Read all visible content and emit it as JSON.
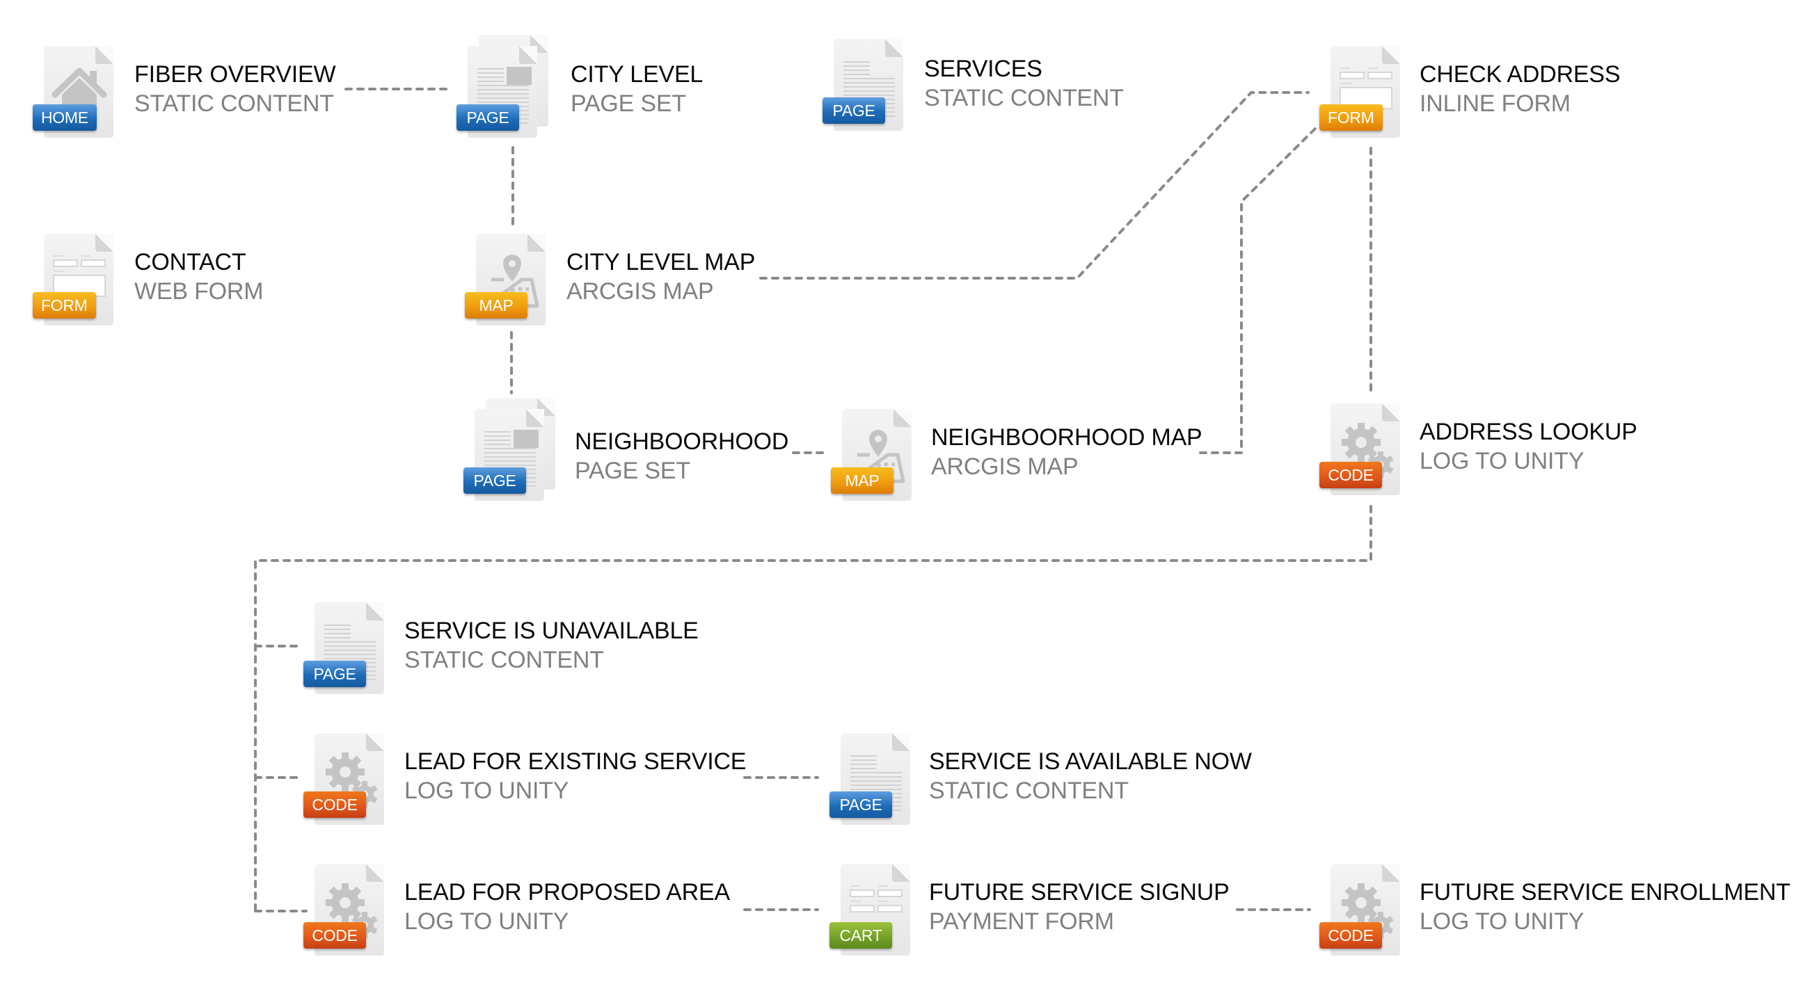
{
  "diagram": {
    "badge_colors": {
      "blue": "#1e6cb8",
      "orange": "#ef9a0f",
      "red": "#e0561a",
      "green": "#71a027"
    },
    "connector_color": "#8a8a8a",
    "nodes": [
      {
        "id": "fiber-overview",
        "badge": "HOME",
        "icon": "home-icon",
        "title": "FIBER OVERVIEW",
        "subtitle": "STATIC CONTENT"
      },
      {
        "id": "city-level",
        "badge": "PAGE",
        "icon": "page-set-icon",
        "title": "CITY LEVEL",
        "subtitle": "PAGE SET"
      },
      {
        "id": "services",
        "badge": "PAGE",
        "icon": "page-icon",
        "title": "SERVICES",
        "subtitle": "STATIC CONTENT"
      },
      {
        "id": "check-address",
        "badge": "FORM",
        "icon": "form-icon",
        "title": "CHECK ADDRESS",
        "subtitle": "INLINE FORM"
      },
      {
        "id": "contact",
        "badge": "FORM",
        "icon": "form-icon",
        "title": "CONTACT",
        "subtitle": "WEB FORM"
      },
      {
        "id": "city-level-map",
        "badge": "MAP",
        "icon": "map-icon",
        "title": "CITY LEVEL MAP",
        "subtitle": "ARCGIS MAP"
      },
      {
        "id": "neighboorhood",
        "badge": "PAGE",
        "icon": "page-set-icon",
        "title": "NEIGHBOORHOOD",
        "subtitle": "PAGE SET"
      },
      {
        "id": "neighboorhood-map",
        "badge": "MAP",
        "icon": "map-icon",
        "title": "NEIGHBOORHOOD MAP",
        "subtitle": "ARCGIS MAP"
      },
      {
        "id": "address-lookup",
        "badge": "CODE",
        "icon": "gears-icon",
        "title": "ADDRESS LOOKUP",
        "subtitle": "LOG TO UNITY"
      },
      {
        "id": "service-unavailable",
        "badge": "PAGE",
        "icon": "page-icon",
        "title": "SERVICE IS UNAVAILABLE",
        "subtitle": "STATIC CONTENT"
      },
      {
        "id": "lead-existing-service",
        "badge": "CODE",
        "icon": "gears-icon",
        "title": "LEAD FOR EXISTING SERVICE",
        "subtitle": "LOG TO UNITY"
      },
      {
        "id": "service-available-now",
        "badge": "PAGE",
        "icon": "page-icon",
        "title": "SERVICE IS AVAILABLE NOW",
        "subtitle": "STATIC CONTENT"
      },
      {
        "id": "lead-proposed-area",
        "badge": "CODE",
        "icon": "gears-icon",
        "title": "LEAD FOR PROPOSED AREA",
        "subtitle": "LOG TO UNITY"
      },
      {
        "id": "future-service-signup",
        "badge": "CART",
        "icon": "payment-form-icon",
        "title": "FUTURE SERVICE SIGNUP",
        "subtitle": "PAYMENT FORM"
      },
      {
        "id": "future-service-enrollment",
        "badge": "CODE",
        "icon": "gears-icon",
        "title": "FUTURE SERVICE ENROLLMENT",
        "subtitle": "LOG TO UNITY"
      }
    ],
    "edges": [
      {
        "from": "fiber-overview",
        "to": "city-level"
      },
      {
        "from": "city-level",
        "to": "city-level-map"
      },
      {
        "from": "city-level-map",
        "to": "neighboorhood"
      },
      {
        "from": "neighboorhood",
        "to": "neighboorhood-map"
      },
      {
        "from": "city-level-map",
        "to": "check-address"
      },
      {
        "from": "neighboorhood-map",
        "to": "check-address"
      },
      {
        "from": "check-address",
        "to": "address-lookup"
      },
      {
        "from": "address-lookup",
        "to": "service-unavailable"
      },
      {
        "from": "address-lookup",
        "to": "lead-existing-service"
      },
      {
        "from": "address-lookup",
        "to": "lead-proposed-area"
      },
      {
        "from": "lead-existing-service",
        "to": "service-available-now"
      },
      {
        "from": "lead-proposed-area",
        "to": "future-service-signup"
      },
      {
        "from": "future-service-signup",
        "to": "future-service-enrollment"
      }
    ]
  }
}
